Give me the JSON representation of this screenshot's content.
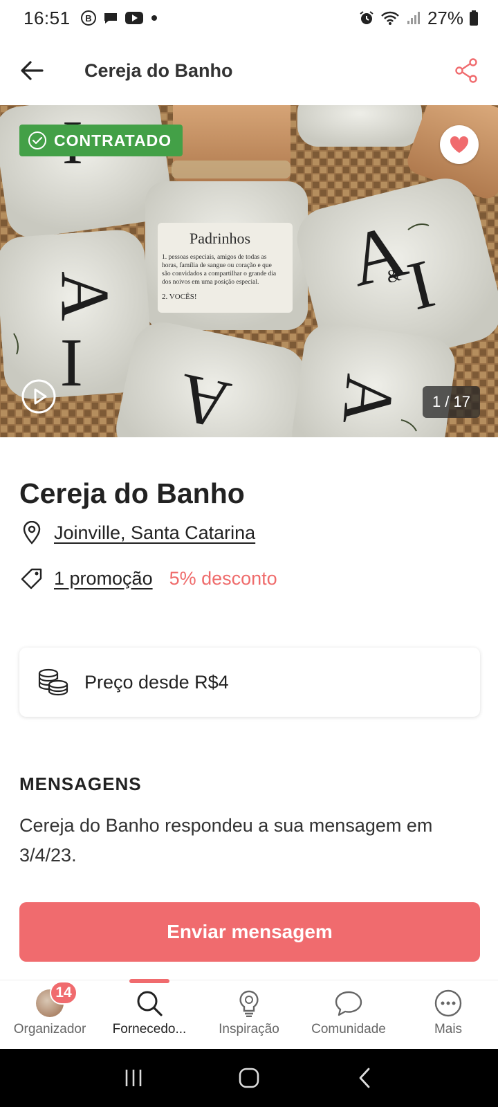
{
  "status_bar": {
    "time": "16:51",
    "battery": "27%",
    "left_icons": [
      "b-badge-icon",
      "chat-bubble-icon",
      "youtube-icon",
      "dot-icon"
    ],
    "right_icons": [
      "alarm-icon",
      "wifi-icon",
      "signal-icon",
      "battery-icon"
    ]
  },
  "app_bar": {
    "title": "Cereja do Banho"
  },
  "hero": {
    "badge": "CONTRATADO",
    "counter": "1 / 17",
    "jar_label_title": "Padrinhos",
    "jar_label_lines": [
      "1. pessoas especiais, amigos de todas as",
      "horas, família de sangue ou coração e que",
      "são convidados a compartilhar o grande dia",
      "dos noivos em uma posição especial.",
      "2. VOCÊS!"
    ],
    "monogram_a": "A",
    "monogram_i": "I",
    "monogram_amp": "&"
  },
  "vendor": {
    "name": "Cereja do Banho",
    "location": "Joinville, Santa Catarina",
    "promotion": "1 promoção",
    "discount": "5% desconto",
    "price": "Preço desde R$4"
  },
  "messages": {
    "heading": "MENSAGENS",
    "text": "Cereja do Banho respondeu a sua mensagem em 3/4/23."
  },
  "cta": {
    "label": "Enviar mensagem"
  },
  "bottom_nav": {
    "items": [
      {
        "label": "Organizador",
        "badge": "14"
      },
      {
        "label": "Fornecedo..."
      },
      {
        "label": "Inspiração"
      },
      {
        "label": "Comunidade"
      },
      {
        "label": "Mais"
      }
    ]
  },
  "colors": {
    "accent": "#f06b6e",
    "success": "#43a047",
    "text": "#222222"
  }
}
